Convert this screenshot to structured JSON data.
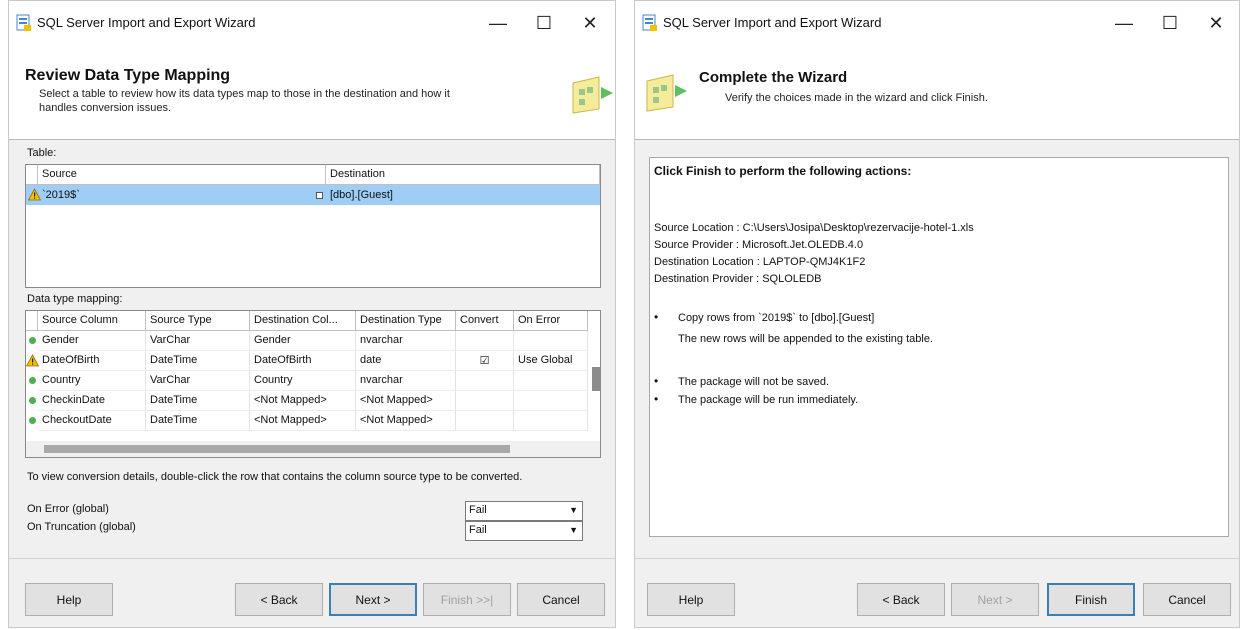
{
  "left_window": {
    "title": "SQL Server Import and Export Wizard",
    "controls": {
      "minimize": "—",
      "maximize": "☐",
      "close": "✕"
    },
    "header_title": "Review Data Type Mapping",
    "header_subtitle_line1": "Select a table to review how its data types map to those in the destination and how it",
    "header_subtitle_line2": "handles conversion issues.",
    "table_label": "Table:",
    "table_columns": [
      "Source",
      "Destination"
    ],
    "table_rows": [
      {
        "source": "`2019$`",
        "destination": "[dbo].[Guest]",
        "status": "warning"
      }
    ],
    "mapping_label": "Data type mapping:",
    "mapping_columns": [
      "Source Column",
      "Source Type",
      "Destination Col...",
      "Destination Type",
      "Convert",
      "On Error"
    ],
    "mapping_rows": [
      {
        "status": "ok",
        "source_column": "Gender",
        "source_type": "VarChar",
        "destination_column": "Gender",
        "destination_type": "nvarchar",
        "convert": "",
        "on_error": ""
      },
      {
        "status": "warning",
        "source_column": "DateOfBirth",
        "source_type": "DateTime",
        "destination_column": "DateOfBirth",
        "destination_type": "date",
        "convert": "☑",
        "on_error": "Use Global"
      },
      {
        "status": "ok",
        "source_column": "Country",
        "source_type": "VarChar",
        "destination_column": "Country",
        "destination_type": "nvarchar",
        "convert": "",
        "on_error": ""
      },
      {
        "status": "ok",
        "source_column": "CheckinDate",
        "source_type": "DateTime",
        "destination_column": "<Not Mapped>",
        "destination_type": "<Not Mapped>",
        "convert": "",
        "on_error": ""
      },
      {
        "status": "ok",
        "source_column": "CheckoutDate",
        "source_type": "DateTime",
        "destination_column": "<Not Mapped>",
        "destination_type": "<Not Mapped>",
        "convert": "",
        "on_error": ""
      }
    ],
    "hint": "To view conversion details, double-click the row that contains the column source type to be converted.",
    "on_error_label": "On Error (global)",
    "on_error_value": "Fail",
    "on_truncation_label": "On Truncation (global)",
    "on_truncation_value": "Fail",
    "buttons": {
      "help": "Help",
      "back": "< Back",
      "next": "Next >",
      "finish": "Finish >>|",
      "cancel": "Cancel"
    }
  },
  "right_window": {
    "title": "SQL Server Import and Export Wizard",
    "controls": {
      "minimize": "—",
      "maximize": "☐",
      "close": "✕"
    },
    "header_title": "Complete the Wizard",
    "header_subtitle": "Verify the choices made in the wizard and click Finish.",
    "summary_heading": "Click Finish to perform the following actions:",
    "details": [
      "Source Location : C:\\Users\\Josipa\\Desktop\\rezervacije-hotel-1.xls",
      "Source Provider : Microsoft.Jet.OLEDB.4.0",
      "Destination Location : LAPTOP-QMJ4K1F2",
      "Destination Provider : SQLOLEDB"
    ],
    "actions": [
      {
        "line1": "Copy rows from `2019$` to [dbo].[Guest]",
        "line2": "The new rows will be appended to the existing table."
      },
      {
        "line1": "The package will not be saved.",
        "line2": ""
      },
      {
        "line1": "The package will be run immediately.",
        "line2": ""
      }
    ],
    "buttons": {
      "help": "Help",
      "back": "< Back",
      "next": "Next >",
      "finish": "Finish",
      "cancel": "Cancel"
    }
  },
  "colors": {
    "selection": "#9fcdf5",
    "ok_status": "#4caf50",
    "warning": "#f2c200",
    "default_button_border": "#3c7fb1"
  }
}
